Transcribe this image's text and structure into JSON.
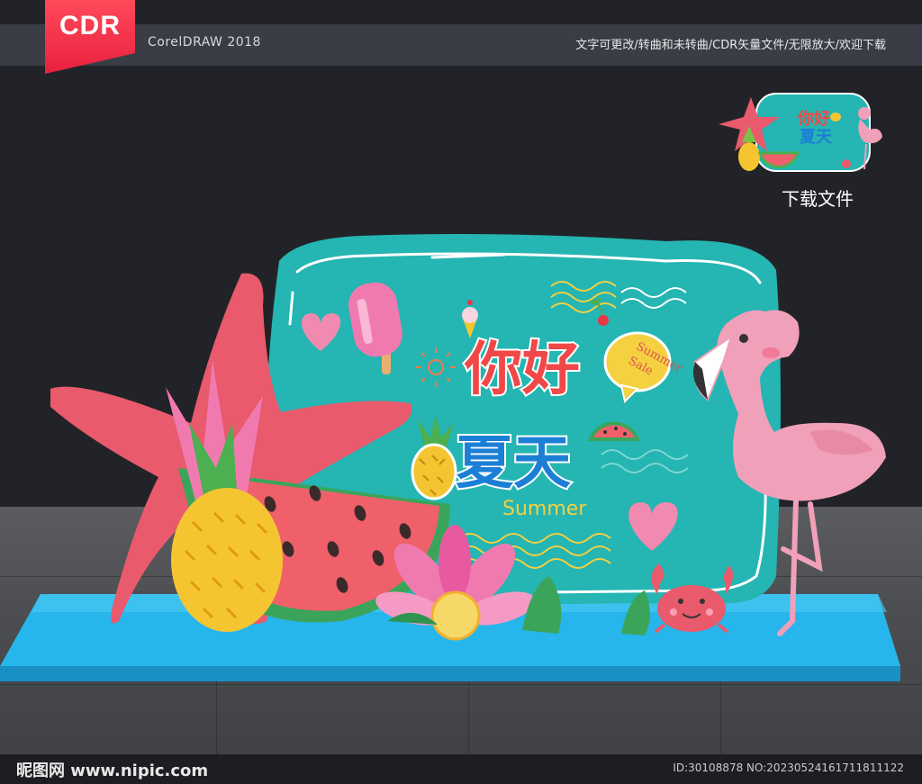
{
  "header": {
    "badge_text": "CDR",
    "app_name": "CorelDRAW 2018",
    "feature_text": "文字可更改/转曲和未转曲/CDR矢量文件/无限放大/欢迎下载"
  },
  "preview": {
    "download_label": "下载文件"
  },
  "artwork": {
    "title_line1": "你好",
    "title_line2": "夏天",
    "subtitle": "Summer",
    "bubble_line1": "Summer",
    "bubble_line2": "Sale",
    "colors": {
      "board": "#25b5b2",
      "stage": "#26b6ec",
      "starfish": "#e85a6c",
      "flamingo": "#f0a0b8",
      "pineapple": "#f5c531",
      "watermelon": "#f0606a",
      "title_red": "#f04848",
      "title_blue": "#1c7fd6"
    }
  },
  "footer": {
    "site": "昵图网 www.nipic.com",
    "id_text": "ID:30108878 NO:20230524161711811122"
  }
}
